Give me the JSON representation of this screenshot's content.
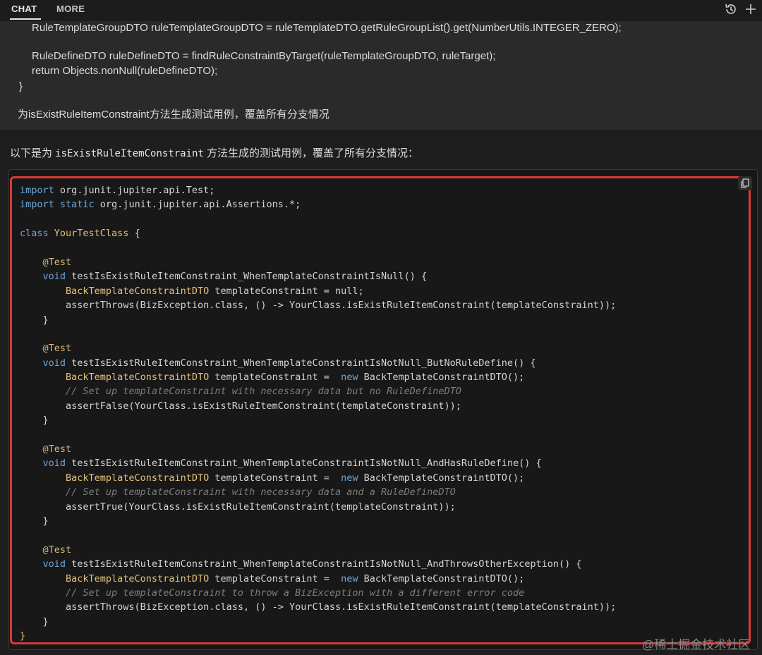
{
  "tabs": [
    {
      "label": "CHAT"
    },
    {
      "label": "MORE"
    }
  ],
  "toolbar": {
    "history_icon": "history-icon",
    "new_icon": "plus-icon"
  },
  "user_message": {
    "lines": [
      "RuleTemplateGroupDTO ruleTemplateGroupDTO = ruleTemplateDTO.getRuleGroupList().get(NumberUtils.INTEGER_ZERO);",
      "",
      "RuleDefineDTO ruleDefineDTO = findRuleConstraintByTarget(ruleTemplateGroupDTO, ruleTarget);",
      "return Objects.nonNull(ruleDefineDTO);",
      "}"
    ],
    "prompt": "为isExistRuleItemConstraint方法生成测试用例，覆盖所有分支情况"
  },
  "assistant": {
    "intro_prefix": "以下是为 ",
    "intro_code": "isExistRuleItemConstraint",
    "intro_suffix": " 方法生成的测试用例，覆盖了所有分支情况："
  },
  "code_lines": [
    [
      [
        "kw",
        "import"
      ],
      [
        "",
        "org.junit.jupiter.api.Test;"
      ]
    ],
    [
      [
        "kw",
        "import static"
      ],
      [
        "",
        "org.junit.jupiter.api.Assertions.*;"
      ]
    ],
    [],
    [
      [
        "kw",
        "class"
      ],
      [
        "ty",
        "YourTestClass"
      ],
      [
        "",
        "{"
      ]
    ],
    [],
    [
      [
        "an",
        "    @Test"
      ]
    ],
    [
      [
        "kw",
        "    void"
      ],
      [
        "",
        "testIsExistRuleItemConstraint_WhenTemplateConstraintIsNull() {"
      ]
    ],
    [
      [
        "ty",
        "        BackTemplateConstraintDTO"
      ],
      [
        "",
        "templateConstraint = null;"
      ]
    ],
    [
      [
        "",
        "        assertThrows(BizException.class, () -> YourClass.isExistRuleItemConstraint(templateConstraint));"
      ]
    ],
    [
      [
        "",
        "    }"
      ]
    ],
    [],
    [
      [
        "an",
        "    @Test"
      ]
    ],
    [
      [
        "kw",
        "    void"
      ],
      [
        "",
        "testIsExistRuleItemConstraint_WhenTemplateConstraintIsNotNull_ButNoRuleDefine() {"
      ]
    ],
    [
      [
        "ty",
        "        BackTemplateConstraintDTO"
      ],
      [
        "",
        "templateConstraint = "
      ],
      [
        "kw",
        "new"
      ],
      [
        "",
        "BackTemplateConstraintDTO();"
      ]
    ],
    [
      [
        "cm",
        "        // Set up templateConstraint with necessary data but no RuleDefineDTO"
      ]
    ],
    [
      [
        "",
        "        assertFalse(YourClass.isExistRuleItemConstraint(templateConstraint));"
      ]
    ],
    [
      [
        "",
        "    }"
      ]
    ],
    [],
    [
      [
        "an",
        "    @Test"
      ]
    ],
    [
      [
        "kw",
        "    void"
      ],
      [
        "",
        "testIsExistRuleItemConstraint_WhenTemplateConstraintIsNotNull_AndHasRuleDefine() {"
      ]
    ],
    [
      [
        "ty",
        "        BackTemplateConstraintDTO"
      ],
      [
        "",
        "templateConstraint = "
      ],
      [
        "kw",
        "new"
      ],
      [
        "",
        "BackTemplateConstraintDTO();"
      ]
    ],
    [
      [
        "cm",
        "        // Set up templateConstraint with necessary data and a RuleDefineDTO"
      ]
    ],
    [
      [
        "",
        "        assertTrue(YourClass.isExistRuleItemConstraint(templateConstraint));"
      ]
    ],
    [
      [
        "",
        "    }"
      ]
    ],
    [],
    [
      [
        "an",
        "    @Test"
      ]
    ],
    [
      [
        "kw",
        "    void"
      ],
      [
        "",
        "testIsExistRuleItemConstraint_WhenTemplateConstraintIsNotNull_AndThrowsOtherException() {"
      ]
    ],
    [
      [
        "ty",
        "        BackTemplateConstraintDTO"
      ],
      [
        "",
        "templateConstraint = "
      ],
      [
        "kw",
        "new"
      ],
      [
        "",
        "BackTemplateConstraintDTO();"
      ]
    ],
    [
      [
        "cm",
        "        // Set up templateConstraint to throw a BizException with a different error code"
      ]
    ],
    [
      [
        "",
        "        assertThrows(BizException.class, () -> YourClass.isExistRuleItemConstraint(templateConstraint));"
      ]
    ],
    [
      [
        "",
        "    }"
      ]
    ],
    [
      [
        "ty",
        "}"
      ]
    ]
  ],
  "copy_icon": "copy-icon",
  "watermark": "@稀土掘金技术社区",
  "colors": {
    "highlight_border": "#d93a35",
    "keyword": "#6fa8dc",
    "type": "#e5c07b",
    "comment": "#7d7d7d"
  }
}
